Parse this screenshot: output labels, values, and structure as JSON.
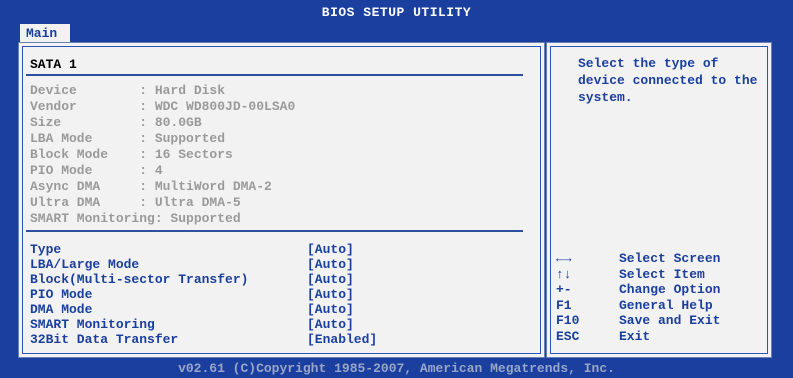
{
  "header": {
    "title": "BIOS SETUP UTILITY"
  },
  "tabs": [
    {
      "label": "Main"
    }
  ],
  "section": {
    "title": "SATA 1"
  },
  "device_info": [
    "Device        : Hard Disk",
    "Vendor        : WDC WD800JD-00LSA0",
    "Size          : 80.0GB",
    "LBA Mode      : Supported",
    "Block Mode    : 16 Sectors",
    "PIO Mode      : 4",
    "Async DMA     : MultiWord DMA-2",
    "Ultra DMA     : Ultra DMA-5",
    "SMART Monitoring: Supported"
  ],
  "settings": [
    {
      "label": "Type",
      "value": "[Auto]"
    },
    {
      "label": "LBA/Large Mode",
      "value": "[Auto]"
    },
    {
      "label": "Block(Multi-sector Transfer)",
      "value": "[Auto]"
    },
    {
      "label": "PIO Mode",
      "value": "[Auto]"
    },
    {
      "label": "DMA Mode",
      "value": "[Auto]"
    },
    {
      "label": "SMART Monitoring",
      "value": "[Auto]"
    },
    {
      "label": "32Bit Data Transfer",
      "value": "[Enabled]"
    }
  ],
  "help": {
    "text": "Select the type of device connected to the system."
  },
  "keys": [
    {
      "key": "←→",
      "desc": "Select Screen"
    },
    {
      "key": "↑↓",
      "desc": "Select Item"
    },
    {
      "key": "+-",
      "desc": "Change Option"
    },
    {
      "key": "F1",
      "desc": "General Help"
    },
    {
      "key": "F10",
      "desc": "Save and Exit"
    },
    {
      "key": "ESC",
      "desc": "Exit"
    }
  ],
  "footer": {
    "text": "v02.61 (C)Copyright 1985-2007, American Megatrends, Inc."
  },
  "colors": {
    "background": "#1a3f9e",
    "panel": "#f2f2f2",
    "text_blue": "#1a3f9e",
    "disabled": "#9a9a9a"
  }
}
